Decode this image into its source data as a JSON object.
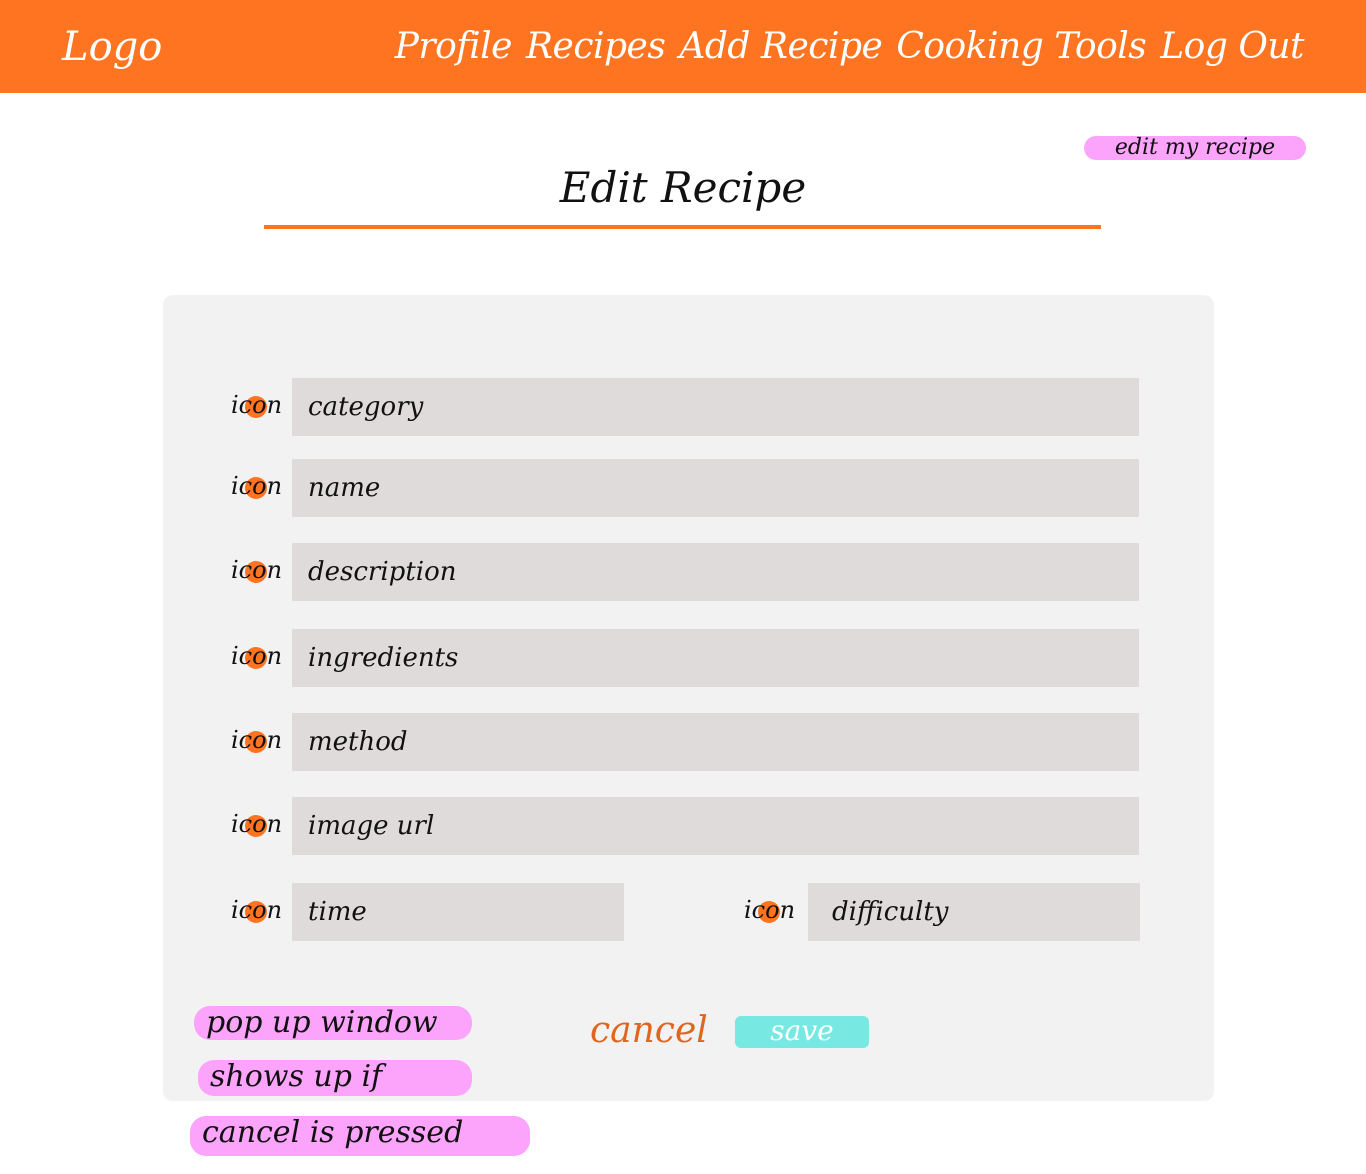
{
  "navbar": {
    "logo": "Logo",
    "items": [
      "Profile",
      "Recipes",
      "Add Recipe",
      "Cooking Tools",
      "Log Out"
    ]
  },
  "annotation_edit": "edit my recipe",
  "page_title": "Edit Recipe",
  "form": {
    "icon_label": "icon",
    "fields": {
      "category": "category",
      "name": "name",
      "description": "description",
      "ingredients": "ingredients",
      "method": "method",
      "image_url": "image url",
      "time": "time",
      "difficulty": "difficulty"
    },
    "cancel_label": "cancel",
    "save_label": "save"
  },
  "note": {
    "lines": [
      "pop up window",
      "shows up if",
      "cancel is pressed"
    ]
  },
  "colors": {
    "accent": "#ff7420",
    "field_bg": "#dfdbda",
    "panel_bg": "#f2f2f2",
    "note_bg": "#fca4fb",
    "save_bg": "#77e8e2"
  }
}
